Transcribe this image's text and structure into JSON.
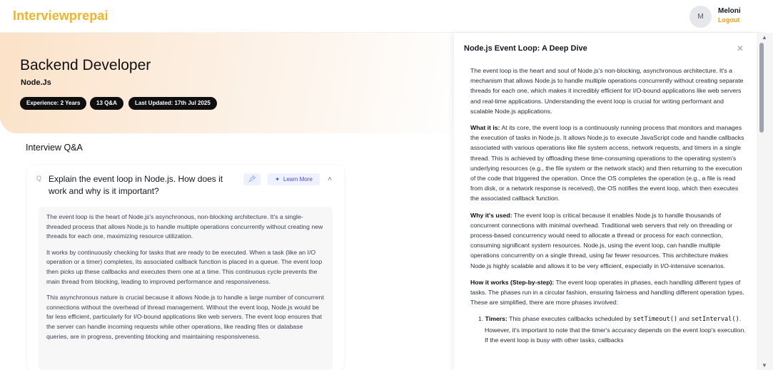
{
  "navbar": {
    "brand": "Interviewprepai",
    "avatar_initial": "M",
    "user_name": "Meloni",
    "logout_label": "Logout"
  },
  "hero": {
    "title": "Backend Developer",
    "subtitle": "Node.Js",
    "chips": [
      "Experience: 2 Years",
      "13 Q&A",
      "Last Updated: 17th Jul 2025"
    ]
  },
  "qa_section": {
    "title": "Interview Q&A",
    "question": "Explain the event loop in Node.js. How does it work and why is it important?",
    "learn_more_label": "Learn More",
    "icons": {
      "question": "search-icon",
      "pin": "pin-icon",
      "learn": "sparkle-icon",
      "collapse": "chevron-up-icon"
    },
    "answer": [
      "The event loop is the heart of Node.js's asynchronous, non-blocking architecture. It's a single-threaded process that allows Node.js to handle multiple operations concurrently without creating new threads for each one, maximizing resource utilization.",
      "It works by continuously checking for tasks that are ready to be executed. When a task (like an I/O operation or a timer) completes, its associated callback function is placed in a queue. The event loop then picks up these callbacks and executes them one at a time. This continuous cycle prevents the main thread from blocking, leading to improved performance and responsiveness.",
      "This asynchronous nature is crucial because it allows Node.js to handle a large number of concurrent connections without the overhead of thread management. Without the event loop, Node.js would be far less efficient, particularly for I/O-bound applications like web servers. The event loop ensures that the server can handle incoming requests while other operations, like reading files or database queries, are in progress, preventing blocking and maintaining responsiveness."
    ]
  },
  "drawer": {
    "title": "Node.js Event Loop: A Deep Dive",
    "intro": "The event loop is the heart and soul of Node.js's non-blocking, asynchronous architecture. It's a mechanism that allows Node.js to handle multiple operations concurrently without creating separate threads for each one, which makes it incredibly efficient for I/O-bound applications like web servers and real-time applications. Understanding the event loop is crucial for writing performant and scalable Node.js applications.",
    "what_label": "What it is:",
    "what_text": " At its core, the event loop is a continuously running process that monitors and manages the execution of tasks in Node.js. It allows Node.js to execute JavaScript code and handle callbacks associated with various operations like file system access, network requests, and timers in a single thread. This is achieved by offloading these time-consuming operations to the operating system's underlying resources (e.g., the file system or the network stack) and then returning to the execution of the code that triggered the operation. Once the OS completes the operation (e.g., a file is read from disk, or a network response is received), the OS notifies the event loop, which then executes the associated callback function.",
    "why_label": "Why it's used:",
    "why_text": " The event loop is critical because it enables Node.js to handle thousands of concurrent connections with minimal overhead. Traditional web servers that rely on threading or process-based concurrency would need to allocate a thread or process for each connection, consuming significant system resources. Node.js, using the event loop, can handle multiple operations concurrently on a single thread, using far fewer resources. This architecture makes Node.js highly scalable and allows it to be very efficient, especially in I/O-intensive scenarios.",
    "how_label": "How it works (Step-by-step):",
    "how_text": " The event loop operates in phases, each handling different types of tasks. The phases run in a circular fashion, ensuring fairness and handling different operation types. These are simplified, there are more phases involved:",
    "list_num": "1.",
    "timers_label": "Timers:",
    "timers_pre": " This phase executes callbacks scheduled by ",
    "code_settimeout": "setTimeout()",
    "timers_and": " and",
    "code_setinterval": "setInterval()",
    "timers_post": ". However, it's important to note that the timer's accuracy depends on the event loop's execution. If the event loop is busy with other tasks, callbacks",
    "close_icon": "close-icon"
  }
}
